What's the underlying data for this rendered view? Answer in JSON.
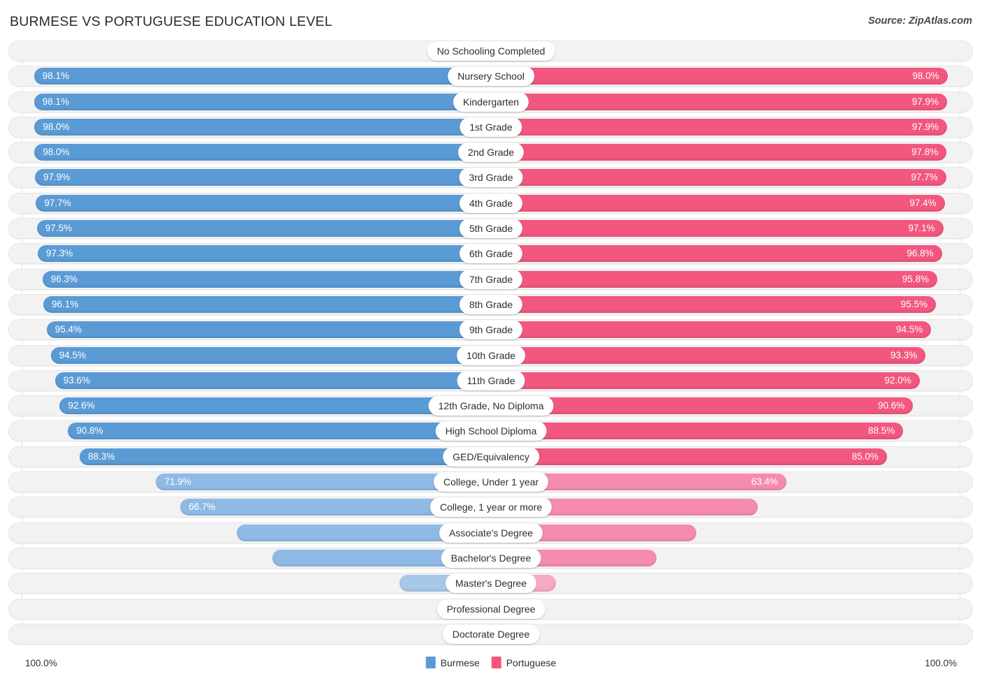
{
  "header": {
    "title": "BURMESE VS PORTUGUESE EDUCATION LEVEL",
    "source": "Source: ZipAtlas.com"
  },
  "footer": {
    "axis_left": "100.0%",
    "axis_right": "100.0%",
    "legend": [
      {
        "label": "Burmese",
        "color": "#5b9bd5"
      },
      {
        "label": "Portuguese",
        "color": "#f2577f"
      }
    ]
  },
  "colors": {
    "burmese": "#5b9bd5",
    "burmese_pale": "#8fbae4",
    "burmese_palest": "#a8c8ea",
    "portuguese": "#f2577f",
    "portuguese_pale": "#f58cb0",
    "portuguese_palest": "#f7a8c4",
    "track": "#f2f2f2",
    "pill": "#ffffff"
  },
  "chart_data": {
    "type": "bar",
    "title": "BURMESE VS PORTUGUESE EDUCATION LEVEL",
    "subtitle": "",
    "xlabel": "",
    "ylabel": "",
    "orientation": "horizontal-diverging",
    "axis_max": 100.0,
    "axis_left_label": "100.0%",
    "axis_right_label": "100.0%",
    "grid": false,
    "legend_position": "bottom-center",
    "legend": [
      "Burmese",
      "Portuguese"
    ],
    "categories": [
      "No Schooling Completed",
      "Nursery School",
      "Kindergarten",
      "1st Grade",
      "2nd Grade",
      "3rd Grade",
      "4th Grade",
      "5th Grade",
      "6th Grade",
      "7th Grade",
      "8th Grade",
      "9th Grade",
      "10th Grade",
      "11th Grade",
      "12th Grade, No Diploma",
      "High School Diploma",
      "GED/Equivalency",
      "College, Under 1 year",
      "College, 1 year or more",
      "Associate's Degree",
      "Bachelor's Degree",
      "Master's Degree",
      "Professional Degree",
      "Doctorate Degree"
    ],
    "series": [
      {
        "name": "Burmese",
        "color": "#5b9bd5",
        "values": [
          1.9,
          98.1,
          98.1,
          98.0,
          98.0,
          97.9,
          97.7,
          97.5,
          97.3,
          96.3,
          96.1,
          95.4,
          94.5,
          93.6,
          92.6,
          90.8,
          88.3,
          71.9,
          66.7,
          54.6,
          46.9,
          19.7,
          6.1,
          2.6
        ]
      },
      {
        "name": "Portuguese",
        "color": "#f2577f",
        "values": [
          2.1,
          98.0,
          97.9,
          97.9,
          97.8,
          97.7,
          97.4,
          97.1,
          96.8,
          95.8,
          95.5,
          94.5,
          93.3,
          92.0,
          90.6,
          88.5,
          85.0,
          63.4,
          57.2,
          44.1,
          35.5,
          13.9,
          4.1,
          1.8
        ]
      }
    ]
  },
  "rows": [
    {
      "label": "No Schooling Completed",
      "left": "1.9%",
      "right": "2.1%",
      "left_val": 1.9,
      "right_val": 2.1,
      "left_in": false,
      "right_in": false,
      "left_tone": "palest",
      "right_tone": "palest"
    },
    {
      "label": "Nursery School",
      "left": "98.1%",
      "right": "98.0%",
      "left_val": 98.1,
      "right_val": 98.0,
      "left_in": true,
      "right_in": true,
      "left_tone": "full",
      "right_tone": "full"
    },
    {
      "label": "Kindergarten",
      "left": "98.1%",
      "right": "97.9%",
      "left_val": 98.1,
      "right_val": 97.9,
      "left_in": true,
      "right_in": true,
      "left_tone": "full",
      "right_tone": "full"
    },
    {
      "label": "1st Grade",
      "left": "98.0%",
      "right": "97.9%",
      "left_val": 98.0,
      "right_val": 97.9,
      "left_in": true,
      "right_in": true,
      "left_tone": "full",
      "right_tone": "full"
    },
    {
      "label": "2nd Grade",
      "left": "98.0%",
      "right": "97.8%",
      "left_val": 98.0,
      "right_val": 97.8,
      "left_in": true,
      "right_in": true,
      "left_tone": "full",
      "right_tone": "full"
    },
    {
      "label": "3rd Grade",
      "left": "97.9%",
      "right": "97.7%",
      "left_val": 97.9,
      "right_val": 97.7,
      "left_in": true,
      "right_in": true,
      "left_tone": "full",
      "right_tone": "full"
    },
    {
      "label": "4th Grade",
      "left": "97.7%",
      "right": "97.4%",
      "left_val": 97.7,
      "right_val": 97.4,
      "left_in": true,
      "right_in": true,
      "left_tone": "full",
      "right_tone": "full"
    },
    {
      "label": "5th Grade",
      "left": "97.5%",
      "right": "97.1%",
      "left_val": 97.5,
      "right_val": 97.1,
      "left_in": true,
      "right_in": true,
      "left_tone": "full",
      "right_tone": "full"
    },
    {
      "label": "6th Grade",
      "left": "97.3%",
      "right": "96.8%",
      "left_val": 97.3,
      "right_val": 96.8,
      "left_in": true,
      "right_in": true,
      "left_tone": "full",
      "right_tone": "full"
    },
    {
      "label": "7th Grade",
      "left": "96.3%",
      "right": "95.8%",
      "left_val": 96.3,
      "right_val": 95.8,
      "left_in": true,
      "right_in": true,
      "left_tone": "full",
      "right_tone": "full"
    },
    {
      "label": "8th Grade",
      "left": "96.1%",
      "right": "95.5%",
      "left_val": 96.1,
      "right_val": 95.5,
      "left_in": true,
      "right_in": true,
      "left_tone": "full",
      "right_tone": "full"
    },
    {
      "label": "9th Grade",
      "left": "95.4%",
      "right": "94.5%",
      "left_val": 95.4,
      "right_val": 94.5,
      "left_in": true,
      "right_in": true,
      "left_tone": "full",
      "right_tone": "full"
    },
    {
      "label": "10th Grade",
      "left": "94.5%",
      "right": "93.3%",
      "left_val": 94.5,
      "right_val": 93.3,
      "left_in": true,
      "right_in": true,
      "left_tone": "full",
      "right_tone": "full"
    },
    {
      "label": "11th Grade",
      "left": "93.6%",
      "right": "92.0%",
      "left_val": 93.6,
      "right_val": 92.0,
      "left_in": true,
      "right_in": true,
      "left_tone": "full",
      "right_tone": "full"
    },
    {
      "label": "12th Grade, No Diploma",
      "left": "92.6%",
      "right": "90.6%",
      "left_val": 92.6,
      "right_val": 90.6,
      "left_in": true,
      "right_in": true,
      "left_tone": "full",
      "right_tone": "full"
    },
    {
      "label": "High School Diploma",
      "left": "90.8%",
      "right": "88.5%",
      "left_val": 90.8,
      "right_val": 88.5,
      "left_in": true,
      "right_in": true,
      "left_tone": "full",
      "right_tone": "full"
    },
    {
      "label": "GED/Equivalency",
      "left": "88.3%",
      "right": "85.0%",
      "left_val": 88.3,
      "right_val": 85.0,
      "left_in": true,
      "right_in": true,
      "left_tone": "full",
      "right_tone": "full"
    },
    {
      "label": "College, Under 1 year",
      "left": "71.9%",
      "right": "63.4%",
      "left_val": 71.9,
      "right_val": 63.4,
      "left_in": true,
      "right_in": true,
      "left_tone": "pale",
      "right_tone": "pale"
    },
    {
      "label": "College, 1 year or more",
      "left": "66.7%",
      "right": "57.2%",
      "left_val": 66.7,
      "right_val": 57.2,
      "left_in": true,
      "right_in": false,
      "left_tone": "pale",
      "right_tone": "pale"
    },
    {
      "label": "Associate's Degree",
      "left": "54.6%",
      "right": "44.1%",
      "left_val": 54.6,
      "right_val": 44.1,
      "left_in": false,
      "right_in": false,
      "left_tone": "pale",
      "right_tone": "pale"
    },
    {
      "label": "Bachelor's Degree",
      "left": "46.9%",
      "right": "35.5%",
      "left_val": 46.9,
      "right_val": 35.5,
      "left_in": false,
      "right_in": false,
      "left_tone": "pale",
      "right_tone": "pale"
    },
    {
      "label": "Master's Degree",
      "left": "19.7%",
      "right": "13.9%",
      "left_val": 19.7,
      "right_val": 13.9,
      "left_in": false,
      "right_in": false,
      "left_tone": "palest",
      "right_tone": "palest"
    },
    {
      "label": "Professional Degree",
      "left": "6.1%",
      "right": "4.1%",
      "left_val": 6.1,
      "right_val": 4.1,
      "left_in": false,
      "right_in": false,
      "left_tone": "palest",
      "right_tone": "palest"
    },
    {
      "label": "Doctorate Degree",
      "left": "2.6%",
      "right": "1.8%",
      "left_val": 2.6,
      "right_val": 1.8,
      "left_in": false,
      "right_in": false,
      "left_tone": "palest",
      "right_tone": "palest"
    }
  ]
}
